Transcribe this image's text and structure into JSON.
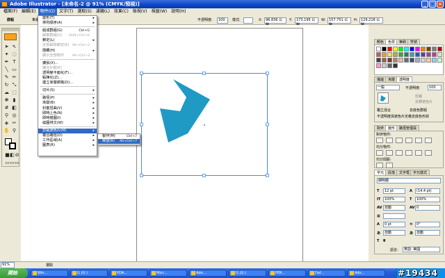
{
  "window": {
    "title": "Adobe Illustrator - [未命名-2 @ 91% (CMYK/預視)]",
    "controls": [
      "_",
      "□",
      "×"
    ]
  },
  "menubar": [
    "檔案(F)",
    "編輯(E)",
    "物件(O)",
    "文字(T)",
    "選取(S)",
    "濾鏡(L)",
    "效果(C)",
    "檢視(V)",
    "視窗(W)",
    "說明(H)"
  ],
  "controlbar": {
    "group_label": "群組",
    "stroke_label": "筆畫",
    "opacity_label": "不透明度:",
    "opacity_value": "100",
    "style_label": "樣式:",
    "x_label": "X:",
    "x_value": "96.836 公釐",
    "y_label": "Y:",
    "y_value": "173.195 公釐",
    "w_label": "W:",
    "w_value": "157.751 公釐",
    "h_label": "H:",
    "h_value": "129.218 公釐"
  },
  "object_menu": {
    "items": [
      {
        "label": "變形(T)",
        "arrow": "▸"
      },
      {
        "label": "排列順序(A)",
        "arrow": "▸"
      },
      {
        "sep": true
      },
      {
        "label": "組成群組(G)",
        "shortcut": "Ctrl+G"
      },
      {
        "label": "解散群組(U)",
        "shortcut": "Shift+Ctrl+G",
        "disabled": true
      },
      {
        "label": "鎖定(L)",
        "arrow": "▸"
      },
      {
        "label": "全部解除鎖定(K)",
        "shortcut": "Alt+Ctrl+2",
        "disabled": true
      },
      {
        "label": "隱藏(H)",
        "arrow": "▸"
      },
      {
        "label": "顯示全部物件",
        "shortcut": "Alt+Ctrl+3",
        "disabled": true
      },
      {
        "sep": true
      },
      {
        "label": "擴張(X)..."
      },
      {
        "label": "擴充外觀(E)",
        "disabled": true
      },
      {
        "label": "透明度平面化(F)..."
      },
      {
        "label": "點陣化(Z)..."
      },
      {
        "label": "建立漸層網格(D)..."
      },
      {
        "sep": true
      },
      {
        "label": "切片(S)",
        "arrow": "▸"
      },
      {
        "sep": true
      },
      {
        "label": "路徑(P)",
        "arrow": "▸"
      },
      {
        "label": "漸變(B)",
        "arrow": "▸"
      },
      {
        "label": "封套扭曲(V)",
        "arrow": "▸"
      },
      {
        "label": "即時上色(N)",
        "arrow": "▸"
      },
      {
        "label": "即時描圖(I)",
        "arrow": "▸"
      },
      {
        "label": "繞圖排文(W)",
        "arrow": "▸"
      },
      {
        "sep": true
      },
      {
        "label": "剪裁遮色片(M)",
        "arrow": "▸",
        "highlighted": true
      },
      {
        "label": "複合路徑(O)",
        "arrow": "▸"
      },
      {
        "label": "工作區域(A)",
        "arrow": "▸"
      },
      {
        "label": "圖表(R)",
        "arrow": "▸"
      }
    ]
  },
  "clipmask_submenu": {
    "items": [
      {
        "label": "製作(M)",
        "shortcut": "Ctrl+7"
      },
      {
        "label": "釋放(R)",
        "shortcut": "Alt+Ctrl+7",
        "highlighted": true
      }
    ]
  },
  "swatches_panel": {
    "tabs": [
      "顏色",
      "色票",
      "筆刷",
      "符號"
    ],
    "colors": [
      "#ffffff",
      "#000000",
      "#ff0000",
      "#ffff00",
      "#00ff00",
      "#00ffff",
      "#0000ff",
      "#ff00ff",
      "#ff7f00",
      "#7f3f00",
      "#808080",
      "#c00000",
      "#e05050",
      "#f0a020",
      "#f0e060",
      "#90c040",
      "#40a040",
      "#208060",
      "#40a0c0",
      "#2060c0",
      "#6040a0",
      "#a040a0",
      "#c04080",
      "#e0e0e0",
      "#404040",
      "#a06040",
      "#704020",
      "#c08060",
      "#e0c0a0",
      "#607080",
      "#305070",
      "#a0b0c0",
      "#d0d8e0",
      "#ffcc99",
      "#99ccff",
      "#ccffcc",
      "#ff99cc",
      "#cccccc",
      "#666666",
      "#333333"
    ]
  },
  "transparency_panel": {
    "tabs": [
      "描邊",
      "漸層",
      "透明度"
    ],
    "mode": "一般",
    "opacity_label": "不透明度:",
    "opacity_value": "100",
    "clip_label": "剪裁",
    "invert_label": "反轉遮色片",
    "isolate_label": "獨立混合",
    "knockout_label": "去底色群組",
    "opacity_mask_label": "不透明度與遮色片定義去底色形狀"
  },
  "align_panel": {
    "tabs": [
      "對齊",
      "變形",
      "路徑管理員"
    ],
    "align_objects_label": "對齊物件:",
    "distribute_objects_label": "均分物件:",
    "distribute_spacing_label": "均分間距:"
  },
  "character_panel": {
    "tabs": [
      "字元",
      "段落",
      "文字框",
      "字元樣式"
    ],
    "font_value": "細明體",
    "size_value": "12 pt",
    "leading_value": "(14.4 pt)",
    "scale_v": "100%",
    "scale_h": "100%",
    "tracking": "自動",
    "kerning": "0",
    "baseline": "0 pt",
    "rotation": "0°",
    "auto1": "自動",
    "auto2": "自動",
    "language_label": "語言:",
    "language_value": "英語: 美國"
  },
  "statusbar": {
    "zoom": "91%",
    "tool": "選取"
  },
  "taskbar": {
    "start_label": "開始",
    "tasks": [
      "Win...",
      "G (G:)",
      "PDA...",
      "Micr...",
      "Ado...",
      "G (G:)",
      "PER...",
      "Def...",
      "Ado..."
    ],
    "watermark": "#19434"
  },
  "colors": {
    "shape_fill": "#1e9ac4",
    "selection": "#4a8ad4",
    "menu_highlight": "#316ac5"
  }
}
